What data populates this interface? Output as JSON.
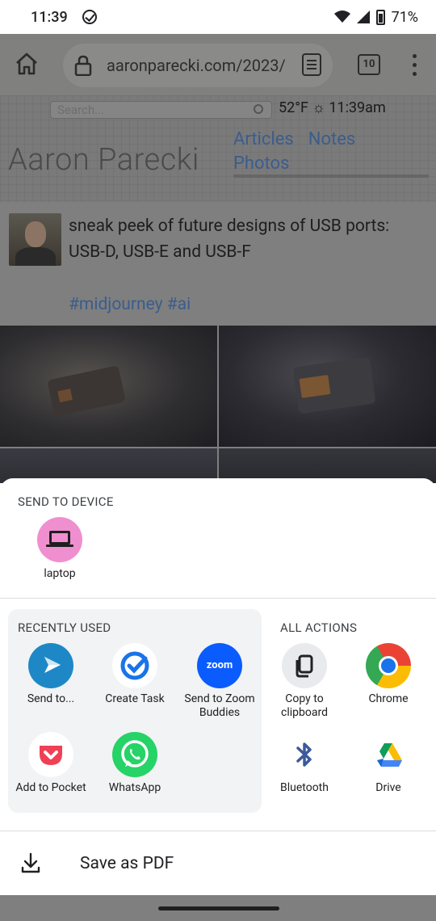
{
  "status_bar": {
    "time": "11:39",
    "battery": "71%"
  },
  "browser": {
    "url": "aaronparecki.com/2023/",
    "tab_count": "10"
  },
  "webpage": {
    "search_placeholder": "Search...",
    "weather": "52°F ☼ 11:39am",
    "site_name": "Aaron Parecki",
    "nav": [
      "Articles",
      "Notes",
      "Photos"
    ],
    "post_text": "sneak peek of future designs of USB ports: USB-D, USB-E and USB-F",
    "post_tags": "#midjourney #ai"
  },
  "share_sheet": {
    "send_to_device": {
      "heading": "SEND TO DEVICE",
      "devices": [
        {
          "label": "laptop",
          "icon": "laptop-icon",
          "color": "#f08fcf"
        }
      ]
    },
    "recently_used": {
      "heading": "RECENTLY USED",
      "apps": [
        {
          "label": "Send to...",
          "icon": "send-to-icon"
        },
        {
          "label": "Create Task",
          "icon": "task-check-icon"
        },
        {
          "label": "Send to Zoom Buddies",
          "icon": "zoom-icon",
          "icon_text": "zoom"
        },
        {
          "label": "Add to Pocket",
          "icon": "pocket-icon"
        },
        {
          "label": "WhatsApp",
          "icon": "whatsapp-icon"
        }
      ]
    },
    "all_actions": {
      "heading": "ALL ACTIONS",
      "apps": [
        {
          "label": "Copy to clipboard",
          "icon": "clipboard-icon"
        },
        {
          "label": "Chrome",
          "icon": "chrome-icon"
        },
        {
          "label": "Bluetooth",
          "icon": "bluetooth-icon"
        },
        {
          "label": "Drive",
          "icon": "drive-icon"
        }
      ]
    },
    "save_pdf": {
      "label": "Save as PDF",
      "icon": "download-icon"
    }
  },
  "colors": {
    "scrim": "#7f7f7f",
    "send_to_blue": "#1e88c7",
    "task_blue": "#1a73e8",
    "zoom_blue": "#0b5cff",
    "pocket_red": "#ef4056",
    "whatsapp_green": "#25d366",
    "bluetooth_blue": "#3c5a9a"
  }
}
